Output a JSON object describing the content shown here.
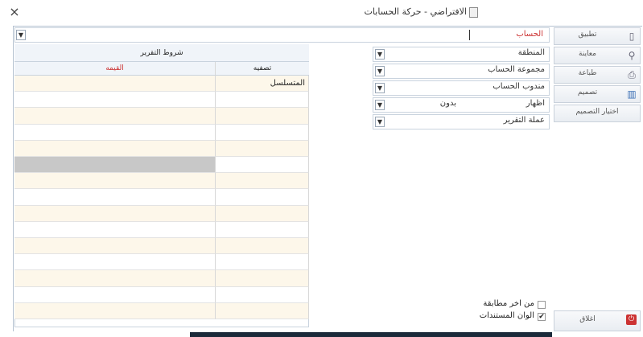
{
  "window": {
    "title": "الافتراضي - حركة الحسابات",
    "close_symbol": "×"
  },
  "account_field": {
    "label": "الحساب",
    "value": ""
  },
  "filters": [
    {
      "label": "المنطقة",
      "value": ""
    },
    {
      "label": "مجموعة الحساب",
      "value": ""
    },
    {
      "label": "مندوب الحساب",
      "value": ""
    },
    {
      "label": "اظهار",
      "value": "بدون"
    },
    {
      "label": "عملة التقرير",
      "value": ""
    }
  ],
  "report_conditions": {
    "title": "شروط التقرير",
    "columns": {
      "filter": "تصفيه",
      "value": "القيمه"
    },
    "rows": [
      {
        "filter": "المتسلسل",
        "value": ""
      },
      {
        "filter": "",
        "value": ""
      },
      {
        "filter": "",
        "value": ""
      },
      {
        "filter": "",
        "value": ""
      },
      {
        "filter": "",
        "value": ""
      },
      {
        "filter": "",
        "value": ""
      },
      {
        "filter": "",
        "value": ""
      },
      {
        "filter": "",
        "value": ""
      },
      {
        "filter": "",
        "value": ""
      },
      {
        "filter": "",
        "value": ""
      },
      {
        "filter": "",
        "value": ""
      },
      {
        "filter": "",
        "value": ""
      },
      {
        "filter": "",
        "value": ""
      },
      {
        "filter": "",
        "value": ""
      },
      {
        "filter": "",
        "value": ""
      }
    ]
  },
  "sidebar": {
    "apply": "تطبيق",
    "preview": "معاينة",
    "print": "طباعة",
    "design": "تصميم",
    "choose_design": "اختيار التصميم",
    "close": "اغلاق"
  },
  "options": {
    "from_last_match": {
      "label": "من اخر مطابقة",
      "checked": false
    },
    "document_colors": {
      "label": "الوان المستندات",
      "checked": true
    }
  },
  "colors": {
    "row_alt": "#fdf7ea",
    "selected_row": "#c8c8c8",
    "accent_red": "#cc3333",
    "header_bg": "#f0f4f9"
  }
}
